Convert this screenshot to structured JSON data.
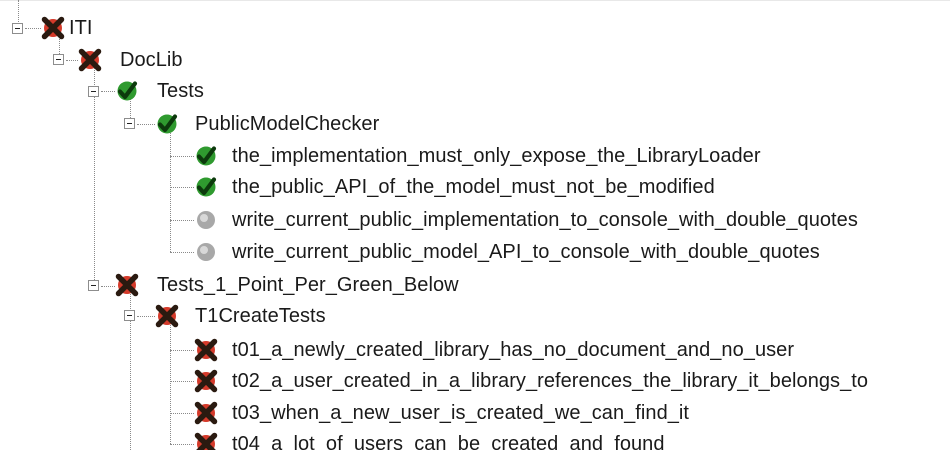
{
  "tree": {
    "nodes": [
      {
        "label": "ITI",
        "status": "failed",
        "expanded": true
      },
      {
        "label": "DocLib",
        "status": "failed",
        "expanded": true
      },
      {
        "label": "Tests",
        "status": "passed",
        "expanded": true
      },
      {
        "label": "PublicModelChecker",
        "status": "passed",
        "expanded": true
      },
      {
        "label": "the_implementation_must_only_expose_the_LibraryLoader",
        "status": "passed"
      },
      {
        "label": "the_public_API_of_the_model_must_not_be_modified",
        "status": "passed"
      },
      {
        "label": "write_current_public_implementation_to_console_with_double_quotes",
        "status": "not-run"
      },
      {
        "label": "write_current_public_model_API_to_console_with_double_quotes",
        "status": "not-run"
      },
      {
        "label": "Tests_1_Point_Per_Green_Below",
        "status": "failed",
        "expanded": true
      },
      {
        "label": "T1CreateTests",
        "status": "failed",
        "expanded": true
      },
      {
        "label": "t01_a_newly_created_library_has_no_document_and_no_user",
        "status": "failed"
      },
      {
        "label": "t02_a_user_created_in_a_library_references_the_library_it_belongs_to",
        "status": "failed"
      },
      {
        "label": "t03_when_a_new_user_is_created_we_can_find_it",
        "status": "failed"
      },
      {
        "label": "t04_a_lot_of_users_can_be_created_and_found",
        "status": "failed"
      }
    ],
    "icons": {
      "failed": "failed-x-icon",
      "passed": "passed-check-icon",
      "not-run": "not-run-circle-icon"
    },
    "colors": {
      "failed_x": "#2a1a10",
      "failed_badge": "#d43a2a",
      "passed_badge": "#2f9a2f",
      "passed_check": "#0c3a0c",
      "not_run": "#a8a8a8",
      "connector": "#8a8a8a"
    }
  }
}
